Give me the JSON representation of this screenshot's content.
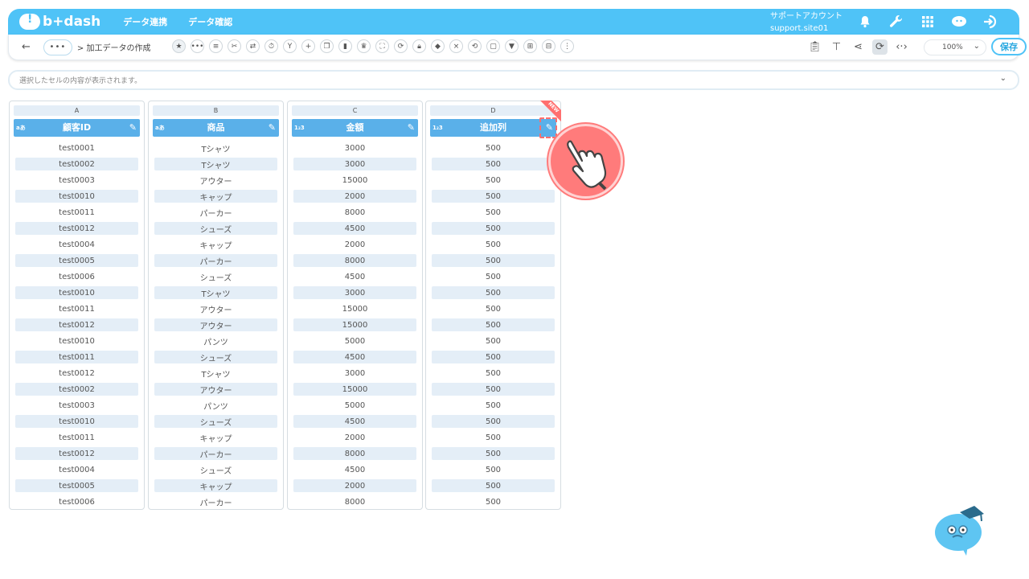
{
  "header": {
    "logo_text": "b+dash",
    "nav": [
      "データ連携",
      "データ確認"
    ],
    "account_line1": "サポートアカウント",
    "account_line2": "support.site01",
    "icons": [
      "bell-icon",
      "wrench-icon",
      "grid-icon",
      "chat-icon",
      "logout-icon"
    ]
  },
  "toolbar": {
    "back_label": "←",
    "more_label": "•••",
    "breadcrumb": "> 加工データの作成",
    "zoom": "100%",
    "save_label": "保存"
  },
  "cellbar": {
    "placeholder": "選択したセルの内容が表示されます。"
  },
  "columns": [
    {
      "letter": "A",
      "type_icon": "a-icon",
      "type_label": "aあ",
      "name": "顧客ID",
      "rows": [
        "test0001",
        "test0002",
        "test0003",
        "test0010",
        "test0011",
        "test0012",
        "test0004",
        "test0005",
        "test0006",
        "test0010",
        "test0011",
        "test0012",
        "test0010",
        "test0011",
        "test0012",
        "test0002",
        "test0003",
        "test0010",
        "test0011",
        "test0012",
        "test0004",
        "test0005",
        "test0006"
      ]
    },
    {
      "letter": "B",
      "type_icon": "a-icon",
      "type_label": "aあ",
      "name": "商品",
      "rows": [
        "Tシャツ",
        "Tシャツ",
        "アウター",
        "キャップ",
        "パーカー",
        "シューズ",
        "キャップ",
        "パーカー",
        "シューズ",
        "Tシャツ",
        "アウター",
        "アウター",
        "パンツ",
        "シューズ",
        "Tシャツ",
        "アウター",
        "パンツ",
        "シューズ",
        "キャップ",
        "パーカー",
        "シューズ",
        "キャップ",
        "パーカー"
      ]
    },
    {
      "letter": "C",
      "type_icon": "number-icon",
      "type_label": "1₂3",
      "name": "金額",
      "rows": [
        "3000",
        "3000",
        "15000",
        "2000",
        "8000",
        "4500",
        "2000",
        "8000",
        "4500",
        "3000",
        "15000",
        "15000",
        "5000",
        "4500",
        "3000",
        "15000",
        "5000",
        "4500",
        "2000",
        "8000",
        "4500",
        "2000",
        "8000"
      ]
    },
    {
      "letter": "D",
      "type_icon": "number-icon",
      "type_label": "1₂3",
      "name": "追加列",
      "badge": "NEW",
      "rows": [
        "500",
        "500",
        "500",
        "500",
        "500",
        "500",
        "500",
        "500",
        "500",
        "500",
        "500",
        "500",
        "500",
        "500",
        "500",
        "500",
        "500",
        "500",
        "500",
        "500",
        "500",
        "500",
        "500"
      ]
    }
  ],
  "colors": {
    "accent": "#4fc3f7",
    "column_header": "#5ab0e9",
    "alt_row": "#e4eef7",
    "highlight": "#ff7b7b"
  }
}
